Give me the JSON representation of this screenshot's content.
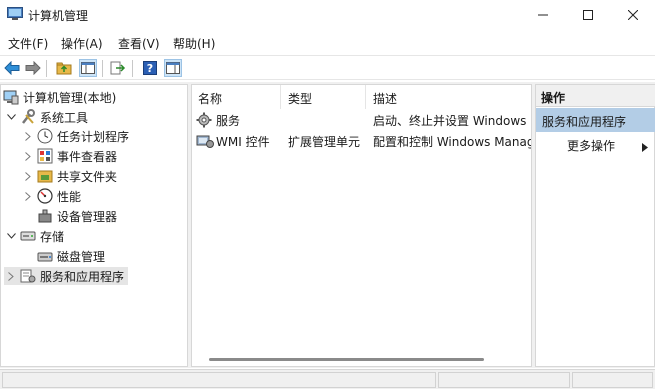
{
  "window": {
    "title": "计算机管理",
    "controls": [
      "minimize",
      "maximize",
      "close"
    ]
  },
  "menu": [
    "文件(F)",
    "操作(A)",
    "查看(V)",
    "帮助(H)"
  ],
  "toolbar": {
    "buttons": [
      "back-icon",
      "forward-icon",
      "up-folder-icon",
      "show-tree-icon",
      "export-icon",
      "help-icon",
      "show-action-pane-icon"
    ]
  },
  "tree": {
    "items": [
      {
        "label": "计算机管理(本地)",
        "icon": "computer-management-icon",
        "expander": "none"
      },
      {
        "label": "系统工具",
        "icon": "system-tools-icon",
        "expander": "expanded"
      },
      {
        "label": "任务计划程序",
        "icon": "task-scheduler-icon",
        "expander": "collapsed"
      },
      {
        "label": "事件查看器",
        "icon": "event-viewer-icon",
        "expander": "collapsed"
      },
      {
        "label": "共享文件夹",
        "icon": "shared-folders-icon",
        "expander": "collapsed"
      },
      {
        "label": "性能",
        "icon": "performance-icon",
        "expander": "collapsed"
      },
      {
        "label": "设备管理器",
        "icon": "device-manager-icon",
        "expander": "none"
      },
      {
        "label": "存储",
        "icon": "storage-icon",
        "expander": "expanded"
      },
      {
        "label": "磁盘管理",
        "icon": "disk-management-icon",
        "expander": "none"
      },
      {
        "label": "服务和应用程序",
        "icon": "services-apps-icon",
        "expander": "collapsed",
        "selected": true
      }
    ]
  },
  "list": {
    "columns": [
      "名称",
      "类型",
      "描述"
    ],
    "rows": [
      {
        "name": "服务",
        "type": "",
        "description": "启动、终止并设置 Windows",
        "icon": "services-gear-icon"
      },
      {
        "name": "WMI 控件",
        "type": "扩展管理单元",
        "description": "配置和控制 Windows Manag",
        "icon": "wmi-control-icon"
      }
    ]
  },
  "actions": {
    "header": "操作",
    "section": "服务和应用程序",
    "items": [
      "更多操作"
    ]
  },
  "colors": {
    "accent_selection": "#b3cde6",
    "tree_selection": "#e5e5e5",
    "pane_background": "#f0f0f0"
  }
}
